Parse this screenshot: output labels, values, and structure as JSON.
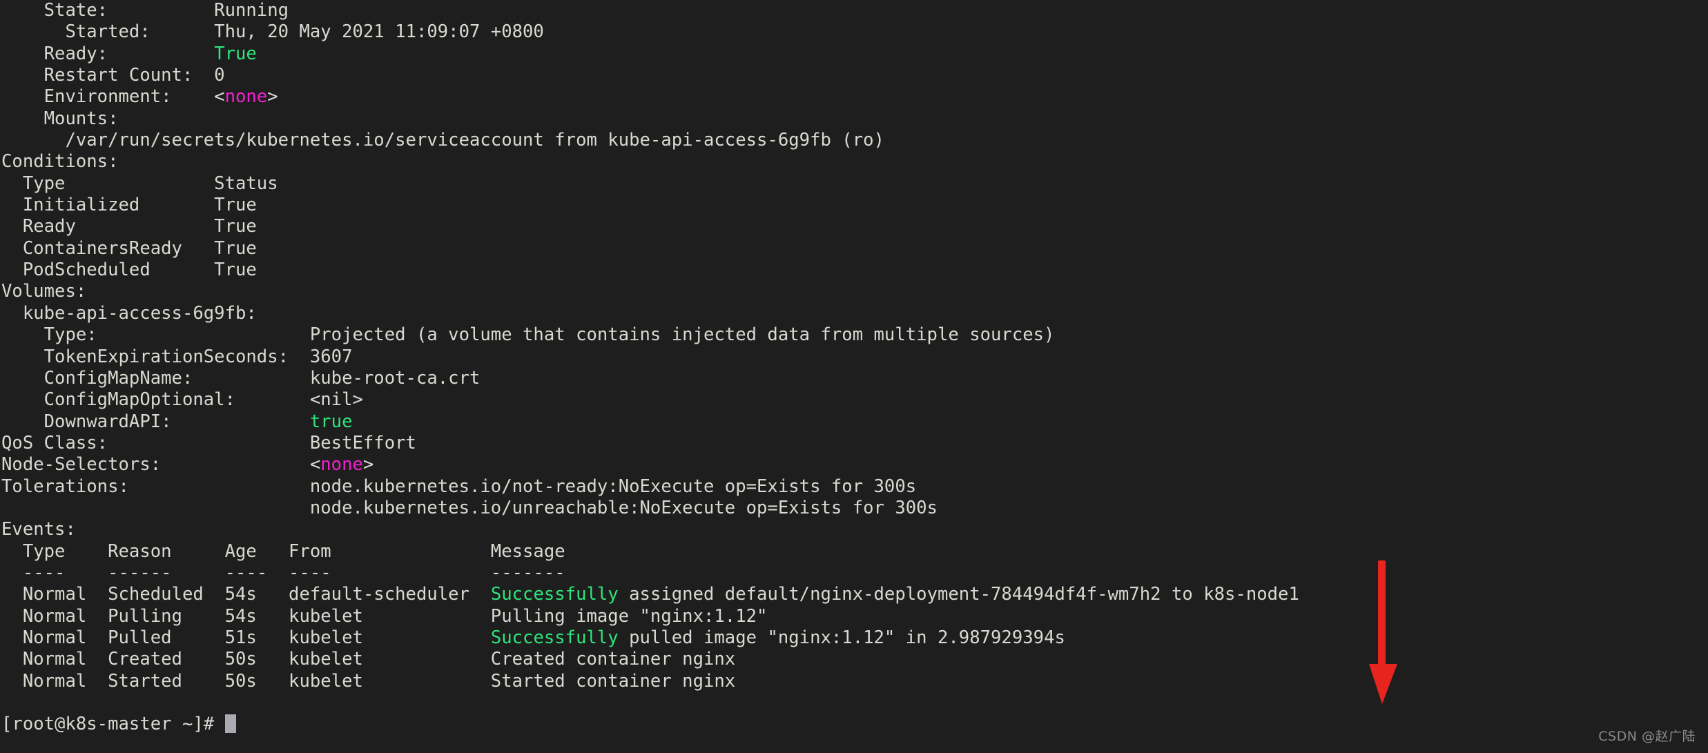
{
  "terminal": {
    "background_color": "#1e1e1e",
    "foreground_color": "#d9d9d2",
    "green_color": "#2ee47b",
    "magenta_color": "#f020d0",
    "prompt": "[root@k8s-master ~]# "
  },
  "pod_status": {
    "state_label": "    State:",
    "state_value": "          Running",
    "started_label": "      Started:",
    "started_value": "      Thu, 20 May 2021 11:09:07 +0800",
    "ready_label": "    Ready:",
    "ready_value": "          True",
    "restart_count_label": "    Restart Count:",
    "restart_count_value": "  0",
    "environment_label": "    Environment:",
    "environment_value": "    <none>",
    "mounts_label": "    Mounts:",
    "mounts_value": "      /var/run/secrets/kubernetes.io/serviceaccount from kube-api-access-6g9fb (ro)"
  },
  "conditions": {
    "heading": "Conditions:",
    "columns": [
      "Type",
      "Status"
    ],
    "rows": [
      {
        "type": "Initialized",
        "status": "True"
      },
      {
        "type": "Ready",
        "status": "True"
      },
      {
        "type": "ContainersReady",
        "status": "True"
      },
      {
        "type": "PodScheduled",
        "status": "True"
      }
    ]
  },
  "volumes": {
    "heading": "Volumes:",
    "name": "  kube-api-access-6g9fb:",
    "fields": [
      {
        "label": "    Type:",
        "value": "Projected (a volume that contains injected data from multiple sources)"
      },
      {
        "label": "    TokenExpirationSeconds:",
        "value": "3607"
      },
      {
        "label": "    ConfigMapName:",
        "value": "kube-root-ca.crt"
      },
      {
        "label": "    ConfigMapOptional:",
        "value": "<nil>"
      },
      {
        "label": "    DownwardAPI:",
        "value": "true"
      }
    ]
  },
  "summary": {
    "qos_class_label": "QoS Class:",
    "qos_class_value": "BestEffort",
    "node_selectors_label": "Node-Selectors:",
    "node_selectors_value": "<none>",
    "tolerations_label": "Tolerations:",
    "tolerations": [
      "node.kubernetes.io/not-ready:NoExecute op=Exists for 300s",
      "node.kubernetes.io/unreachable:NoExecute op=Exists for 300s"
    ]
  },
  "events": {
    "heading": "Events:",
    "columns": [
      "Type",
      "Reason",
      "Age",
      "From",
      "Message"
    ],
    "underlines": [
      "----",
      "------",
      "----",
      "----",
      "-------"
    ],
    "rows": [
      {
        "type": "Normal",
        "reason": "Scheduled",
        "age": "54s",
        "from": "default-scheduler",
        "message_highlight": "Successfully",
        "message_rest": " assigned default/nginx-deployment-784494df4f-wm7h2 to k8s-node1"
      },
      {
        "type": "Normal",
        "reason": "Pulling",
        "age": "54s",
        "from": "kubelet",
        "message_highlight": "",
        "message_rest": "Pulling image \"nginx:1.12\""
      },
      {
        "type": "Normal",
        "reason": "Pulled",
        "age": "51s",
        "from": "kubelet",
        "message_highlight": "Successfully",
        "message_rest": " pulled image \"nginx:1.12\" in 2.987929394s"
      },
      {
        "type": "Normal",
        "reason": "Created",
        "age": "50s",
        "from": "kubelet",
        "message_highlight": "",
        "message_rest": "Created container nginx"
      },
      {
        "type": "Normal",
        "reason": "Started",
        "age": "50s",
        "from": "kubelet",
        "message_highlight": "",
        "message_rest": "Started container nginx"
      }
    ]
  },
  "annotation": {
    "arrow_color": "#e8241f",
    "arrow_name": "down-arrow"
  },
  "watermark": {
    "text": "CSDN @赵广陆"
  },
  "rendered_lines": [
    {
      "segments": [
        {
          "t": "    State:          Running",
          "c": "fg-default"
        }
      ]
    },
    {
      "segments": [
        {
          "t": "      Started:      Thu, 20 May 2021 11:09:07 +0800",
          "c": "fg-default"
        }
      ]
    },
    {
      "segments": [
        {
          "t": "    Ready:          ",
          "c": "fg-default"
        },
        {
          "t": "True",
          "c": "fg-green"
        }
      ]
    },
    {
      "segments": [
        {
          "t": "    Restart Count:  0",
          "c": "fg-default"
        }
      ]
    },
    {
      "segments": [
        {
          "t": "    Environment:    <",
          "c": "fg-default"
        },
        {
          "t": "none",
          "c": "fg-magenta"
        },
        {
          "t": ">",
          "c": "fg-default"
        }
      ]
    },
    {
      "segments": [
        {
          "t": "    Mounts:",
          "c": "fg-default"
        }
      ]
    },
    {
      "segments": [
        {
          "t": "      /var/run/secrets/kubernetes.io/serviceaccount from kube-api-access-6g9fb (ro)",
          "c": "fg-default"
        }
      ]
    },
    {
      "segments": [
        {
          "t": "Conditions:",
          "c": "fg-default"
        }
      ]
    },
    {
      "segments": [
        {
          "t": "  Type              Status",
          "c": "fg-default"
        }
      ]
    },
    {
      "segments": [
        {
          "t": "  Initialized       True",
          "c": "fg-default"
        }
      ]
    },
    {
      "segments": [
        {
          "t": "  Ready             True",
          "c": "fg-default"
        }
      ]
    },
    {
      "segments": [
        {
          "t": "  ContainersReady   True",
          "c": "fg-default"
        }
      ]
    },
    {
      "segments": [
        {
          "t": "  PodScheduled      True",
          "c": "fg-default"
        }
      ]
    },
    {
      "segments": [
        {
          "t": "Volumes:",
          "c": "fg-default"
        }
      ]
    },
    {
      "segments": [
        {
          "t": "  kube-api-access-6g9fb:",
          "c": "fg-default"
        }
      ]
    },
    {
      "segments": [
        {
          "t": "    Type:                    Projected (a volume that contains injected data from multiple sources)",
          "c": "fg-default"
        }
      ]
    },
    {
      "segments": [
        {
          "t": "    TokenExpirationSeconds:  3607",
          "c": "fg-default"
        }
      ]
    },
    {
      "segments": [
        {
          "t": "    ConfigMapName:           kube-root-ca.crt",
          "c": "fg-default"
        }
      ]
    },
    {
      "segments": [
        {
          "t": "    ConfigMapOptional:       <nil>",
          "c": "fg-default"
        }
      ]
    },
    {
      "segments": [
        {
          "t": "    DownwardAPI:             ",
          "c": "fg-default"
        },
        {
          "t": "true",
          "c": "fg-green"
        }
      ]
    },
    {
      "segments": [
        {
          "t": "QoS Class:                   BestEffort",
          "c": "fg-default"
        }
      ]
    },
    {
      "segments": [
        {
          "t": "Node-Selectors:              <",
          "c": "fg-default"
        },
        {
          "t": "none",
          "c": "fg-magenta"
        },
        {
          "t": ">",
          "c": "fg-default"
        }
      ]
    },
    {
      "segments": [
        {
          "t": "Tolerations:                 node.kubernetes.io/not-ready:NoExecute op=Exists for 300s",
          "c": "fg-default"
        }
      ]
    },
    {
      "segments": [
        {
          "t": "                             node.kubernetes.io/unreachable:NoExecute op=Exists for 300s",
          "c": "fg-default"
        }
      ]
    },
    {
      "segments": [
        {
          "t": "Events:",
          "c": "fg-default"
        }
      ]
    },
    {
      "segments": [
        {
          "t": "  Type    Reason     Age   From               Message",
          "c": "fg-default"
        }
      ]
    },
    {
      "segments": [
        {
          "t": "  ----    ------     ----  ----               -------",
          "c": "fg-default"
        }
      ]
    },
    {
      "segments": [
        {
          "t": "  Normal  Scheduled  54s   default-scheduler  ",
          "c": "fg-default"
        },
        {
          "t": "Successfully",
          "c": "fg-green"
        },
        {
          "t": " assigned default/nginx-deployment-784494df4f-wm7h2 to k8s-node1",
          "c": "fg-default"
        }
      ]
    },
    {
      "segments": [
        {
          "t": "  Normal  Pulling    54s   kubelet            Pulling image \"nginx:1.12\"",
          "c": "fg-default"
        }
      ]
    },
    {
      "segments": [
        {
          "t": "  Normal  Pulled     51s   kubelet            ",
          "c": "fg-default"
        },
        {
          "t": "Successfully",
          "c": "fg-green"
        },
        {
          "t": " pulled image \"nginx:1.12\" in 2.987929394s",
          "c": "fg-default"
        }
      ]
    },
    {
      "segments": [
        {
          "t": "  Normal  Created    50s   kubelet            Created container nginx",
          "c": "fg-default"
        }
      ]
    },
    {
      "segments": [
        {
          "t": "  Normal  Started    50s   kubelet            Started container nginx",
          "c": "fg-default"
        }
      ]
    },
    {
      "segments": [
        {
          "t": "",
          "c": "fg-default"
        }
      ]
    },
    {
      "segments": [
        {
          "t": "[root@k8s-master ~]# ",
          "c": "fg-default"
        }
      ],
      "cursor": true
    }
  ]
}
